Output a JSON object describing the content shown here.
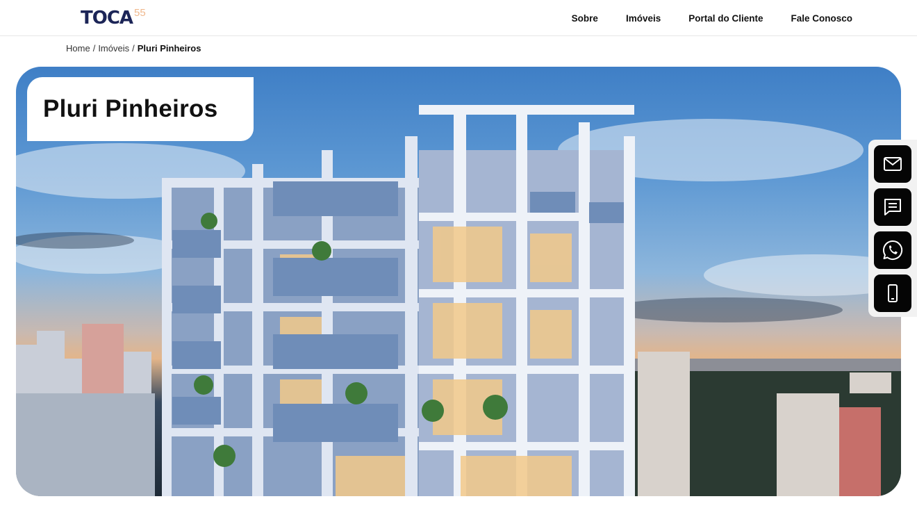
{
  "header": {
    "logo_text": "TOCA",
    "logo_number": "55",
    "nav": [
      {
        "label": "Sobre"
      },
      {
        "label": "Imóveis"
      },
      {
        "label": "Portal do Cliente"
      },
      {
        "label": "Fale Conosco"
      }
    ]
  },
  "breadcrumb": {
    "home": "Home",
    "category": "Imóveis",
    "current": "Pluri Pinheiros",
    "separator": "/"
  },
  "hero": {
    "title": "Pluri Pinheiros",
    "image_description_icon": "building-render-image"
  },
  "contact": {
    "buttons": [
      {
        "icon": "email-icon"
      },
      {
        "icon": "chat-icon"
      },
      {
        "icon": "whatsapp-icon"
      },
      {
        "icon": "phone-icon"
      }
    ]
  },
  "colors": {
    "brand_navy": "#1c2557",
    "brand_accent": "#f0b98e",
    "contact_button_bg": "#050505",
    "contact_bar_bg": "#f2f2f2"
  }
}
